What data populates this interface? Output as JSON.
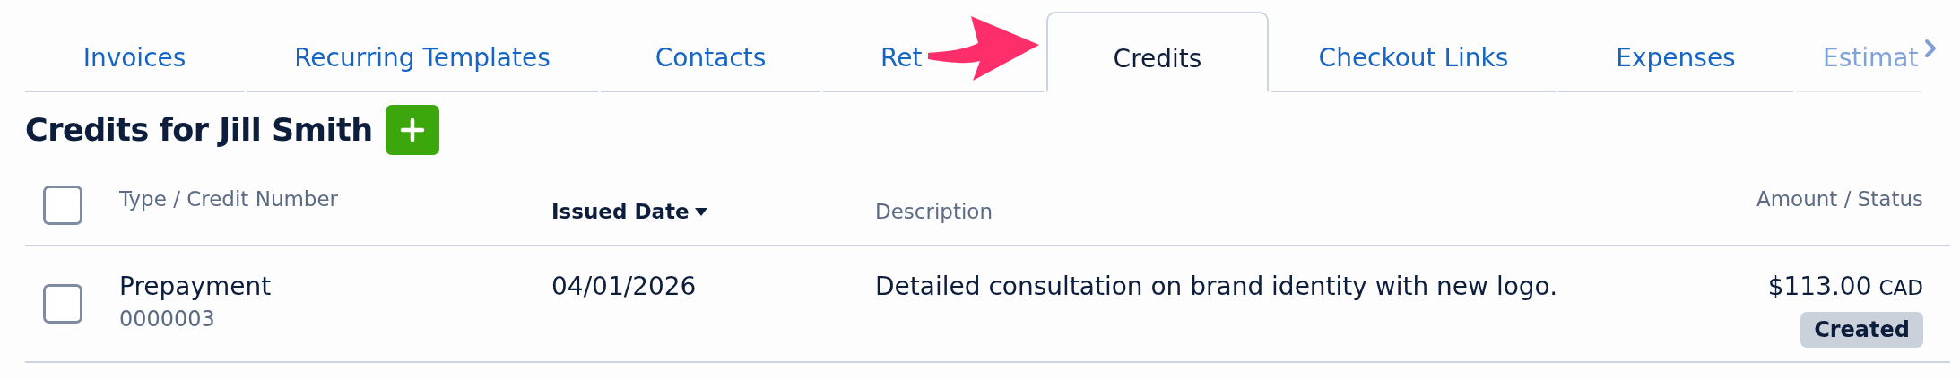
{
  "tabs": [
    {
      "label": "Invoices",
      "selected": false,
      "faded": false
    },
    {
      "label": "Recurring Templates",
      "selected": false,
      "faded": false
    },
    {
      "label": "Contacts",
      "selected": false,
      "faded": false
    },
    {
      "label": "Ret",
      "selected": false,
      "faded": false
    },
    {
      "label": "Credits",
      "selected": true,
      "faded": false
    },
    {
      "label": "Checkout Links",
      "selected": false,
      "faded": false
    },
    {
      "label": "Expenses",
      "selected": false,
      "faded": false
    },
    {
      "label": "Estimat",
      "selected": false,
      "faded": true
    }
  ],
  "heading": "Credits for Jill Smith",
  "table": {
    "select_all": {
      "checked": false
    },
    "columns": [
      {
        "label": "Type / Credit Number",
        "sorted": false
      },
      {
        "label": "Issued Date",
        "sorted": true
      },
      {
        "label": "Description",
        "sorted": false
      },
      {
        "label": "Amount / Status",
        "sorted": false
      }
    ],
    "rows": [
      {
        "checked": false,
        "type": "Prepayment",
        "number": "0000003",
        "issued_date": "04/01/2026",
        "description": "Detailed consultation on brand identity with new logo.",
        "amount": "$113.00",
        "currency": "CAD",
        "status": "Created"
      }
    ]
  }
}
